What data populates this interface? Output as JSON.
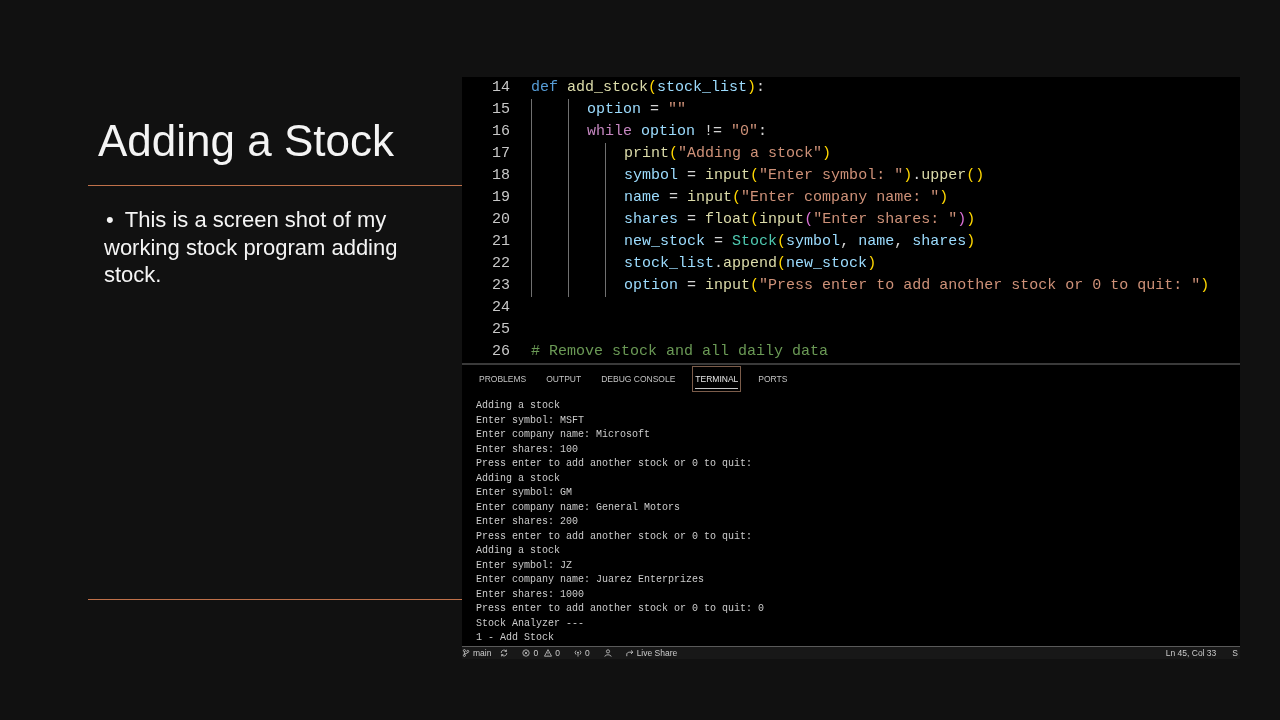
{
  "slide": {
    "title": "Adding a Stock",
    "bullets": [
      {
        "marker": "•",
        "text": "This is a screen shot of my working stock program adding stock."
      }
    ]
  },
  "editor": {
    "lines": [
      {
        "number": "14",
        "tokens": [
          {
            "kind": "keyword",
            "text": "def "
          },
          {
            "kind": "function",
            "text": "add_stock"
          },
          {
            "kind": "bracket1",
            "text": "("
          },
          {
            "kind": "variable",
            "text": "stock_list"
          },
          {
            "kind": "bracket1",
            "text": ")"
          },
          {
            "kind": "plain",
            "text": ":"
          }
        ]
      },
      {
        "number": "15",
        "tokens": [
          {
            "kind": "variable",
            "text": "      option"
          },
          {
            "kind": "plain",
            "text": " = "
          },
          {
            "kind": "string",
            "text": "\"\""
          }
        ]
      },
      {
        "number": "16",
        "tokens": [
          {
            "kind": "control",
            "text": "      while "
          },
          {
            "kind": "variable",
            "text": "option"
          },
          {
            "kind": "plain",
            "text": " != "
          },
          {
            "kind": "string",
            "text": "\"0\""
          },
          {
            "kind": "plain",
            "text": ":"
          }
        ]
      },
      {
        "number": "17",
        "tokens": [
          {
            "kind": "function",
            "text": "          print"
          },
          {
            "kind": "bracket1",
            "text": "("
          },
          {
            "kind": "string",
            "text": "\"Adding a stock\""
          },
          {
            "kind": "bracket1",
            "text": ")"
          }
        ]
      },
      {
        "number": "18",
        "tokens": [
          {
            "kind": "variable",
            "text": "          symbol"
          },
          {
            "kind": "plain",
            "text": " = "
          },
          {
            "kind": "function",
            "text": "input"
          },
          {
            "kind": "bracket1",
            "text": "("
          },
          {
            "kind": "string",
            "text": "\"Enter symbol: \""
          },
          {
            "kind": "bracket1",
            "text": ")"
          },
          {
            "kind": "plain",
            "text": "."
          },
          {
            "kind": "function",
            "text": "upper"
          },
          {
            "kind": "bracket1",
            "text": "()"
          }
        ]
      },
      {
        "number": "19",
        "tokens": [
          {
            "kind": "variable",
            "text": "          name"
          },
          {
            "kind": "plain",
            "text": " = "
          },
          {
            "kind": "function",
            "text": "input"
          },
          {
            "kind": "bracket1",
            "text": "("
          },
          {
            "kind": "string",
            "text": "\"Enter company name: \""
          },
          {
            "kind": "bracket1",
            "text": ")"
          }
        ]
      },
      {
        "number": "20",
        "tokens": [
          {
            "kind": "variable",
            "text": "          shares"
          },
          {
            "kind": "plain",
            "text": " = "
          },
          {
            "kind": "function",
            "text": "float"
          },
          {
            "kind": "bracket1",
            "text": "("
          },
          {
            "kind": "function",
            "text": "input"
          },
          {
            "kind": "bracket2",
            "text": "("
          },
          {
            "kind": "string",
            "text": "\"Enter shares: \""
          },
          {
            "kind": "bracket2",
            "text": ")"
          },
          {
            "kind": "bracket1",
            "text": ")"
          }
        ]
      },
      {
        "number": "21",
        "tokens": [
          {
            "kind": "variable",
            "text": "          new_stock"
          },
          {
            "kind": "plain",
            "text": " = "
          },
          {
            "kind": "class",
            "text": "Stock"
          },
          {
            "kind": "bracket1",
            "text": "("
          },
          {
            "kind": "variable",
            "text": "symbol"
          },
          {
            "kind": "plain",
            "text": ", "
          },
          {
            "kind": "variable",
            "text": "name"
          },
          {
            "kind": "plain",
            "text": ", "
          },
          {
            "kind": "variable",
            "text": "shares"
          },
          {
            "kind": "bracket1",
            "text": ")"
          }
        ]
      },
      {
        "number": "22",
        "tokens": [
          {
            "kind": "variable",
            "text": "          stock_list"
          },
          {
            "kind": "plain",
            "text": "."
          },
          {
            "kind": "function",
            "text": "append"
          },
          {
            "kind": "bracket1",
            "text": "("
          },
          {
            "kind": "variable",
            "text": "new_stock"
          },
          {
            "kind": "bracket1",
            "text": ")"
          }
        ]
      },
      {
        "number": "23",
        "tokens": [
          {
            "kind": "variable",
            "text": "          option"
          },
          {
            "kind": "plain",
            "text": " = "
          },
          {
            "kind": "function",
            "text": "input"
          },
          {
            "kind": "bracket1",
            "text": "("
          },
          {
            "kind": "string",
            "text": "\"Press enter to add another stock or 0 to quit: \""
          },
          {
            "kind": "bracket1",
            "text": ")"
          }
        ]
      },
      {
        "number": "24"
      },
      {
        "number": "25"
      },
      {
        "number": "26",
        "tokens": [
          {
            "kind": "comment",
            "text": "# Remove stock and all daily data"
          }
        ]
      }
    ]
  },
  "panel": {
    "tabs": [
      {
        "label": "PROBLEMS",
        "selected": false
      },
      {
        "label": "OUTPUT",
        "selected": false
      },
      {
        "label": "DEBUG CONSOLE",
        "selected": false
      },
      {
        "label": "TERMINAL",
        "selected": true
      },
      {
        "label": "PORTS",
        "selected": false
      }
    ],
    "terminal_lines": [
      "Adding a stock",
      "Enter symbol: MSFT",
      "Enter company name: Microsoft",
      "Enter shares: 100",
      "Press enter to add another stock or 0 to quit:",
      "Adding a stock",
      "Enter symbol: GM",
      "Enter company name: General Motors",
      "Enter shares: 200",
      "Press enter to add another stock or 0 to quit:",
      "Adding a stock",
      "Enter symbol: JZ",
      "Enter company name: Juarez Enterprizes",
      "Enter shares: 1000",
      "Press enter to add another stock or 0 to quit: 0",
      "Stock Analyzer ---",
      "1 - Add Stock"
    ]
  },
  "status_bar": {
    "branch": "main",
    "errors": "0",
    "warnings": "0",
    "ports": "0",
    "live_share": "Live Share",
    "cursor_position": "Ln 45, Col 33",
    "trailing_item": "S"
  }
}
